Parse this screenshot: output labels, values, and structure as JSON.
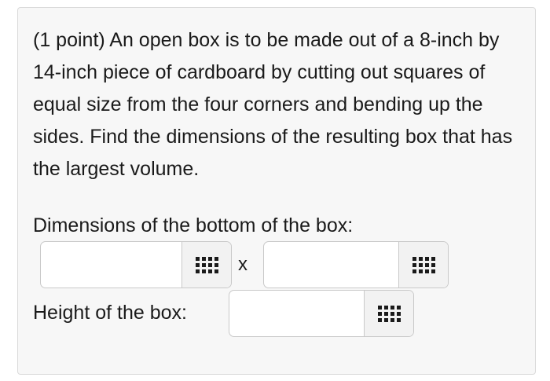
{
  "problem": {
    "text": "(1 point) An open box is to be made out of a 8-inch by 14-inch piece of cardboard by cutting out squares of equal size from the four corners and bending up the sides. Find the dimensions of the resulting box that has the largest volume."
  },
  "labels": {
    "bottom_dimensions": "Dimensions of the bottom of the box:",
    "times": "x",
    "height": "Height of the box:"
  },
  "inputs": {
    "bottom_width": {
      "value": ""
    },
    "bottom_length": {
      "value": ""
    },
    "height": {
      "value": ""
    }
  },
  "icons": {
    "keypad": "keypad-grid-icon"
  },
  "colors": {
    "panel_background": "#f7f7f7",
    "panel_border": "#dadada",
    "icon": "#1a1a1a"
  }
}
